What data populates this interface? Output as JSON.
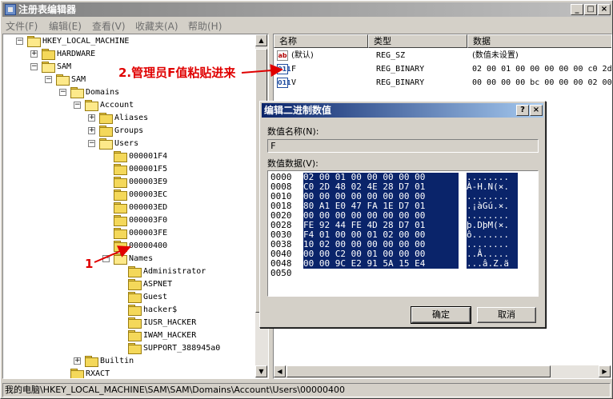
{
  "window": {
    "title": "注册表编辑器",
    "min": "_",
    "max": "□",
    "close": "×"
  },
  "menu": [
    "文件(F)",
    "编辑(E)",
    "查看(V)",
    "收藏夹(A)",
    "帮助(H)"
  ],
  "tree": [
    {
      "label": "HKEY_LOCAL_MACHINE",
      "exp": "−"
    },
    {
      "label": "HARDWARE",
      "exp": "+"
    },
    {
      "label": "SAM",
      "exp": "−"
    },
    {
      "label": "SAM",
      "exp": "−"
    },
    {
      "label": "Domains",
      "exp": "−"
    },
    {
      "label": "Account",
      "exp": "−"
    },
    {
      "label": "Aliases",
      "exp": "+"
    },
    {
      "label": "Groups",
      "exp": "+"
    },
    {
      "label": "Users",
      "exp": "−"
    },
    {
      "label": "000001F4",
      "exp": ""
    },
    {
      "label": "000001F5",
      "exp": ""
    },
    {
      "label": "000003E9",
      "exp": ""
    },
    {
      "label": "000003EC",
      "exp": ""
    },
    {
      "label": "000003ED",
      "exp": ""
    },
    {
      "label": "000003F0",
      "exp": ""
    },
    {
      "label": "000003FE",
      "exp": ""
    },
    {
      "label": "00000400",
      "exp": ""
    },
    {
      "label": "Names",
      "exp": "−"
    },
    {
      "label": "Administrator",
      "exp": ""
    },
    {
      "label": "ASPNET",
      "exp": ""
    },
    {
      "label": "Guest",
      "exp": ""
    },
    {
      "label": "hacker$",
      "exp": ""
    },
    {
      "label": "IUSR_HACKER",
      "exp": ""
    },
    {
      "label": "IWAM_HACKER",
      "exp": ""
    },
    {
      "label": "SUPPORT_388945a0",
      "exp": ""
    },
    {
      "label": "Builtin",
      "exp": "+"
    },
    {
      "label": "RXACT",
      "exp": ""
    }
  ],
  "list": {
    "headers": [
      "名称",
      "类型",
      "数据"
    ],
    "rows": [
      {
        "icon": "ab",
        "name": "(默认)",
        "type": "REG_SZ",
        "data": "(数值未设置)"
      },
      {
        "icon": "bin",
        "name": "F",
        "type": "REG_BINARY",
        "data": "02 00 01 00 00 00 00 00 c0 2d"
      },
      {
        "icon": "bin",
        "name": "V",
        "type": "REG_BINARY",
        "data": "00 00 00 00 bc 00 00 00 02 00"
      }
    ]
  },
  "dialog": {
    "title": "编辑二进制数值",
    "help": "?",
    "close": "×",
    "name_label": "数值名称(N):",
    "name_value": "F",
    "data_label": "数值数据(V):",
    "hex": [
      {
        "off": "0000",
        "bytes": "02 00 01 00 00 00 00 00",
        "ascii": "........"
      },
      {
        "off": "0008",
        "bytes": "C0 2D 48 02 4E 28 D7 01",
        "ascii": "À-H.N(×."
      },
      {
        "off": "0010",
        "bytes": "00 00 00 00 00 00 00 00",
        "ascii": "........"
      },
      {
        "off": "0018",
        "bytes": "80 A1 E0 47 FA 1E D7 01",
        "ascii": ".¡àGú.×."
      },
      {
        "off": "0020",
        "bytes": "00 00 00 00 00 00 00 00",
        "ascii": "........"
      },
      {
        "off": "0028",
        "bytes": "FE 92 44 FE 4D 28 D7 01",
        "ascii": "þ.DþM(×."
      },
      {
        "off": "0030",
        "bytes": "F4 01 00 00 01 02 00 00",
        "ascii": "ô......."
      },
      {
        "off": "0038",
        "bytes": "10 02 00 00 00 00 00 00",
        "ascii": "........"
      },
      {
        "off": "0040",
        "bytes": "00 00 C2 00 01 00 00 00",
        "ascii": "..Â....."
      },
      {
        "off": "0048",
        "bytes": "00 00 9C E2 91 5A 15 E4",
        "ascii": "...â.Z.ä"
      },
      {
        "off": "0050",
        "bytes": "",
        "ascii": ""
      }
    ],
    "ok": "确定",
    "cancel": "取消"
  },
  "annotations": {
    "step2": "2.管理员F值粘贴进来",
    "step1": "1"
  },
  "status": "我的电脑\\HKEY_LOCAL_MACHINE\\SAM\\SAM\\Domains\\Account\\Users\\00000400"
}
